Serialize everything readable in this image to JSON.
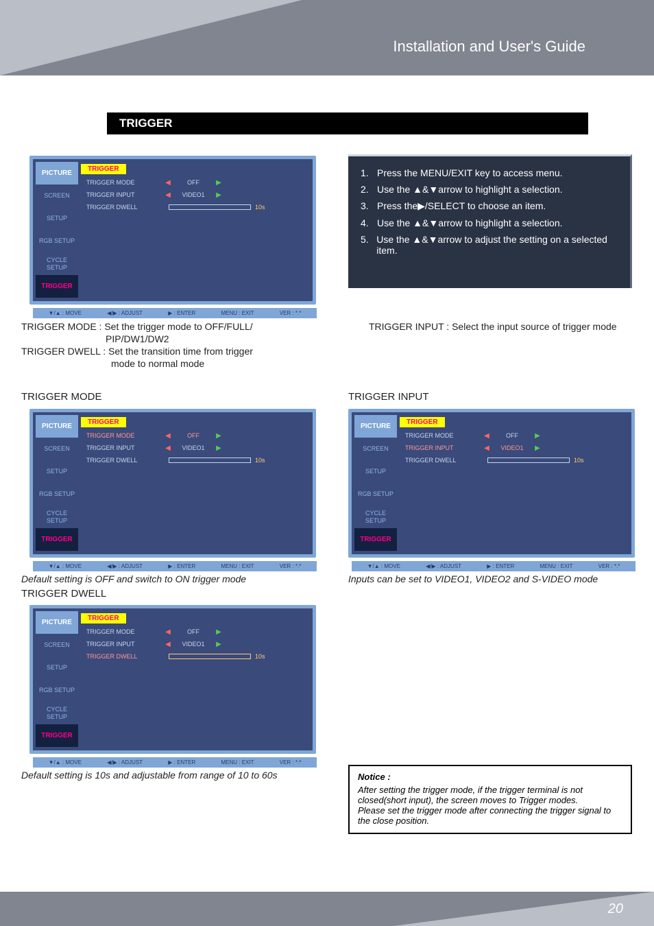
{
  "page": {
    "header_title": "Installation and User's Guide",
    "footer_page": "20"
  },
  "section": {
    "title": "TRIGGER"
  },
  "instructions": {
    "items": [
      {
        "n": "1.",
        "text": "Press the MENU/EXIT key to access menu."
      },
      {
        "n": "2.",
        "text": "Use the ▲&▼arrow to highlight a selection."
      },
      {
        "n": "3.",
        "text": "Press the▶/SELECT to choose an item."
      },
      {
        "n": "4.",
        "text": "Use the ▲&▼arrow to highlight a selection."
      },
      {
        "n": "5.",
        "text": "Use the ▲&▼arrow to adjust the setting on a selected item."
      }
    ]
  },
  "explanations": {
    "mode": "TRIGGER MODE : Set the trigger mode to OFF/FULL/",
    "mode2": "PIP/DW1/DW2",
    "dwell": "TRIGGER DWELL : Set the transition time from trigger",
    "dwell2": "mode to normal mode",
    "input": "TRIGGER INPUT : Select the input source of trigger mode"
  },
  "subtitles": {
    "mode": "TRIGGER MODE",
    "input": "TRIGGER INPUT",
    "dwell": "TRIGGER DWELL"
  },
  "captions": {
    "mode": "Default setting is OFF and switch to ON trigger mode",
    "input": "Inputs can be set to VIDEO1, VIDEO2 and S-VIDEO mode",
    "dwell": "Default setting is 10s and adjustable from range of 10 to 60s"
  },
  "osd": {
    "tabs": [
      "PICTURE",
      "SCREEN",
      "SETUP",
      "RGB SETUP",
      "CYCLE SETUP",
      "TRIGGER"
    ],
    "heading": "TRIGGER",
    "rows": {
      "mode": {
        "label": "TRIGGER MODE",
        "value": "OFF"
      },
      "input": {
        "label": "TRIGGER INPUT",
        "value": "VIDEO1"
      },
      "dwell": {
        "label": "TRIGGER DWELL",
        "value": "10s"
      }
    },
    "footer": [
      "▼/▲ : MOVE",
      "◀/▶ : ADJUST",
      "▶ : ENTER",
      "MENU : EXIT",
      "VER : *.*"
    ]
  },
  "notice": {
    "title": "Notice :",
    "line1": "After setting the trigger mode, if the trigger terminal is not closed(short input), the screen moves to Trigger modes.",
    "line2": "Please set the trigger mode after connecting the trigger signal to the close position."
  }
}
